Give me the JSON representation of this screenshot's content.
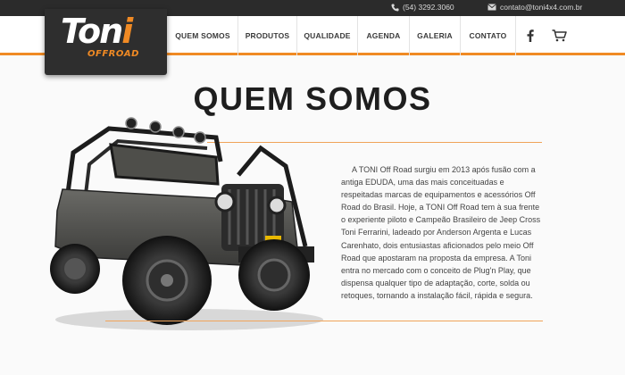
{
  "topbar": {
    "phone": "(54) 3292.3060",
    "email": "contato@toni4x4.com.br",
    "phone_icon": "phone-icon",
    "email_icon": "envelope-icon"
  },
  "logo": {
    "brand_main": "Ton",
    "brand_accent": "i",
    "sub": "OFFROAD"
  },
  "nav": {
    "items": [
      {
        "label": "QUEM SOMOS"
      },
      {
        "label": "PRODUTOS"
      },
      {
        "label": "QUALIDADE"
      },
      {
        "label": "AGENDA"
      },
      {
        "label": "GALERIA"
      },
      {
        "label": "CONTATO"
      }
    ],
    "facebook_icon": "facebook-icon",
    "cart_icon": "cart-icon"
  },
  "main": {
    "title": "QUEM SOMOS",
    "paragraph": "A TONI Off Road surgiu em 2013 após fusão com a antiga EDUDA, uma das mais conceituadas e respeitadas marcas de equipamentos e acessórios Off Road do Brasil. Hoje, a TONI Off Road tem à sua frente o experiente piloto e Campeão Brasileiro de Jeep Cross Toni Ferrarini, ladeado por Anderson Argenta e Lucas Carenhato, dois entusiastas aficionados pelo meio Off Road que apostaram na proposta da empresa. A Toni entra no mercado com o conceito de Plug'n Play, que dispensa qualquer tipo de adaptação, corte, solda ou retoques, tornando a instalação fácil, rápida e segura."
  },
  "colors": {
    "accent": "#f08a24",
    "topbar": "#2b2b2b",
    "logo_bg": "#2e2e2e"
  }
}
